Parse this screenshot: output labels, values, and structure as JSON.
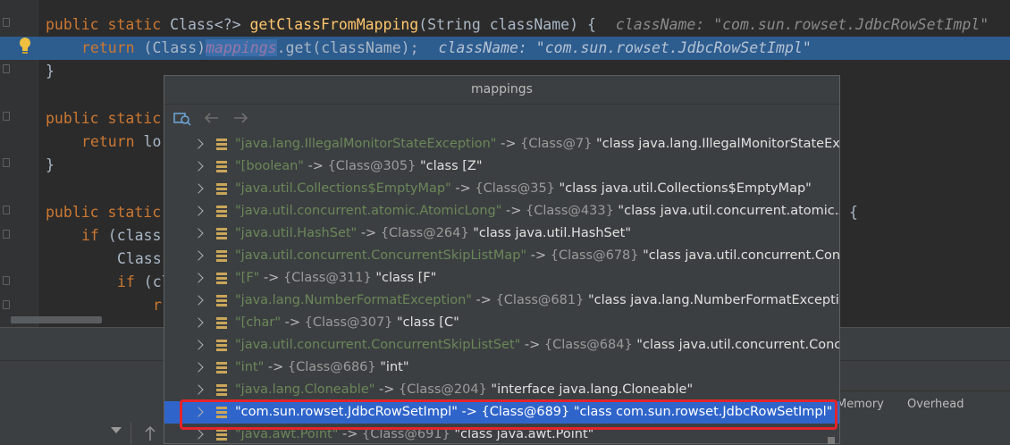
{
  "editor": {
    "lines": [
      {
        "kw1": "public static",
        "rest1": " Class<?> ",
        "fn": "getClassFromMapping",
        "rest2": "(String className) {",
        "hint": "className: \"com.sun.rowset.JdbcRowSetImpl\""
      },
      {
        "kw1": "return",
        "rest1": " (Class)",
        "fld": "mappings",
        "rest2": ".get(className);",
        "hint": "className: \"com.sun.rowset.JdbcRowSetImpl\""
      },
      {
        "text": "}"
      },
      {
        "kw1": "public static",
        "rest1": ""
      },
      {
        "kw1": "return",
        "rest1": " lo"
      },
      {
        "text": "}"
      },
      {
        "kw1": "public static",
        "rest1": "",
        "rest2": "{"
      },
      {
        "kw1": "if",
        "rest1": " (class"
      },
      {
        "text": "Class"
      },
      {
        "kw1": "if",
        "rest1": " (cl"
      },
      {
        "text": "r"
      }
    ]
  },
  "popup": {
    "title": "mappings",
    "rows": [
      {
        "key": "\"java.lang.IllegalMonitorStateException\"",
        "arrow": " -> ",
        "ref": "{Class@7}",
        "val": " \"class java.lang.IllegalMonitorStateExce"
      },
      {
        "key": "\"[boolean\"",
        "arrow": " -> ",
        "ref": "{Class@305}",
        "val": " \"class [Z\""
      },
      {
        "key": "\"java.util.Collections$EmptyMap\"",
        "arrow": " -> ",
        "ref": "{Class@35}",
        "val": " \"class java.util.Collections$EmptyMap\""
      },
      {
        "key": "\"java.util.concurrent.atomic.AtomicLong\"",
        "arrow": " -> ",
        "ref": "{Class@433}",
        "val": " \"class java.util.concurrent.atomic.At"
      },
      {
        "key": "\"java.util.HashSet\"",
        "arrow": " -> ",
        "ref": "{Class@264}",
        "val": " \"class java.util.HashSet\""
      },
      {
        "key": "\"java.util.concurrent.ConcurrentSkipListMap\"",
        "arrow": " -> ",
        "ref": "{Class@678}",
        "val": " \"class java.util.concurrent.Concu"
      },
      {
        "key": "\"[F\"",
        "arrow": " -> ",
        "ref": "{Class@311}",
        "val": " \"class [F\""
      },
      {
        "key": "\"java.lang.NumberFormatException\"",
        "arrow": " -> ",
        "ref": "{Class@681}",
        "val": " \"class java.lang.NumberFormatException"
      },
      {
        "key": "\"[char\"",
        "arrow": " -> ",
        "ref": "{Class@307}",
        "val": " \"class [C\""
      },
      {
        "key": "\"java.util.concurrent.ConcurrentSkipListSet\"",
        "arrow": " -> ",
        "ref": "{Class@684}",
        "val": " \"class java.util.concurrent.Concu"
      },
      {
        "key": "\"int\"",
        "arrow": " -> ",
        "ref": "{Class@686}",
        "val": " \"int\""
      },
      {
        "key": "\"java.lang.Cloneable\"",
        "arrow": " -> ",
        "ref": "{Class@204}",
        "val": " \"interface java.lang.Cloneable\""
      },
      {
        "key": "\"com.sun.rowset.JdbcRowSetImpl\"",
        "arrow": " -> ",
        "ref": "{Class@689}",
        "val": " \"class com.sun.rowset.JdbcRowSetImpl\"",
        "selected": true
      },
      {
        "key": "\"java.awt.Point\"",
        "arrow": " -> ",
        "ref": "{Class@691}",
        "val": " \"class java.awt.Point\""
      }
    ]
  },
  "tool_tabs": {
    "memory": "Memory",
    "overhead": "Overhead"
  },
  "colors": {
    "selected_row": "#2f65ca",
    "highlight_line": "#2d5c8f",
    "annotation": "#e3242b"
  }
}
